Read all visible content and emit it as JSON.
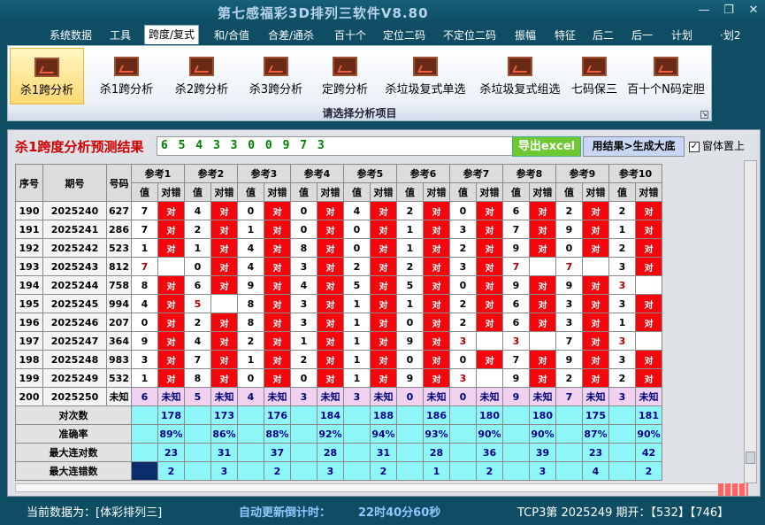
{
  "title": "第七感福彩3D排列三软件V8.80",
  "menu": [
    "系统数据",
    "工具",
    "跨度/复式",
    "和/合值",
    "合差/通杀",
    "百十个",
    "定位二码",
    "不定位二码",
    "振幅",
    "特征",
    "后二",
    "后一",
    "计划",
    "·划2"
  ],
  "ribbon": {
    "buttons": [
      "杀1跨分析",
      "杀1跨分析",
      "杀2跨分析",
      "杀3跨分析",
      "定跨分析",
      "杀垃圾复式单选",
      "杀垃圾复式组选",
      "七码保三",
      "百十个N码定胆"
    ],
    "group_label": "请选择分析项目"
  },
  "result": {
    "title": "杀1跨度分析预测结果",
    "value": "6 5 4 3 3 0 0 9 7 3",
    "excel": "导出excel",
    "gen": "用结果>生成大底",
    "pin_label": "窗体置上"
  },
  "table": {
    "headers": {
      "seq": "序号",
      "period": "期号",
      "code": "号码",
      "refs": [
        "参考1",
        "参考2",
        "参考3",
        "参考4",
        "参考5",
        "参考6",
        "参考7",
        "参考8",
        "参考9",
        "参考10"
      ],
      "val": "值",
      "judge": "对错"
    },
    "rows": [
      {
        "seq": "190",
        "period": "2025240",
        "code": "627",
        "vals": [
          "7",
          "4",
          "0",
          "0",
          "4",
          "2",
          "0",
          "6",
          "2",
          "2"
        ],
        "hit": [
          1,
          1,
          1,
          1,
          1,
          1,
          1,
          1,
          1,
          1
        ]
      },
      {
        "seq": "191",
        "period": "2025241",
        "code": "286",
        "vals": [
          "7",
          "2",
          "1",
          "0",
          "0",
          "1",
          "3",
          "7",
          "9",
          "1"
        ],
        "hit": [
          1,
          1,
          1,
          1,
          1,
          1,
          1,
          1,
          1,
          1
        ]
      },
      {
        "seq": "192",
        "period": "2025242",
        "code": "523",
        "vals": [
          "1",
          "1",
          "4",
          "8",
          "0",
          "1",
          "2",
          "9",
          "0",
          "2"
        ],
        "hit": [
          1,
          1,
          1,
          1,
          1,
          1,
          1,
          1,
          1,
          1
        ]
      },
      {
        "seq": "193",
        "period": "2025243",
        "code": "812",
        "vals": [
          "7",
          "0",
          "4",
          "3",
          "2",
          "2",
          "3",
          "7",
          "7",
          "3"
        ],
        "hit": [
          0,
          1,
          1,
          1,
          1,
          1,
          1,
          0,
          0,
          1
        ]
      },
      {
        "seq": "194",
        "period": "2025244",
        "code": "758",
        "vals": [
          "8",
          "6",
          "9",
          "4",
          "5",
          "5",
          "0",
          "9",
          "9",
          "3"
        ],
        "hit": [
          1,
          1,
          1,
          1,
          1,
          1,
          1,
          1,
          1,
          0
        ]
      },
      {
        "seq": "195",
        "period": "2025245",
        "code": "994",
        "vals": [
          "4",
          "5",
          "8",
          "3",
          "1",
          "1",
          "2",
          "6",
          "3",
          "3"
        ],
        "hit": [
          1,
          0,
          1,
          1,
          1,
          1,
          1,
          1,
          1,
          1
        ]
      },
      {
        "seq": "196",
        "period": "2025246",
        "code": "207",
        "vals": [
          "0",
          "2",
          "8",
          "3",
          "1",
          "0",
          "2",
          "6",
          "3",
          "1"
        ],
        "hit": [
          1,
          1,
          1,
          1,
          1,
          1,
          1,
          1,
          1,
          1
        ]
      },
      {
        "seq": "197",
        "period": "2025247",
        "code": "364",
        "vals": [
          "9",
          "4",
          "2",
          "1",
          "1",
          "9",
          "3",
          "3",
          "7",
          "3"
        ],
        "hit": [
          1,
          1,
          1,
          1,
          1,
          1,
          0,
          0,
          1,
          0
        ]
      },
      {
        "seq": "198",
        "period": "2025248",
        "code": "983",
        "vals": [
          "3",
          "7",
          "1",
          "2",
          "1",
          "0",
          "0",
          "7",
          "9",
          "3"
        ],
        "hit": [
          1,
          1,
          1,
          1,
          1,
          1,
          1,
          1,
          1,
          1
        ]
      },
      {
        "seq": "199",
        "period": "2025249",
        "code": "532",
        "vals": [
          "1",
          "8",
          "0",
          "0",
          "1",
          "9",
          "3",
          "9",
          "2",
          "2"
        ],
        "hit": [
          1,
          1,
          1,
          1,
          1,
          1,
          0,
          1,
          1,
          1
        ]
      }
    ],
    "pending": {
      "seq": "200",
      "period": "2025250",
      "code": "未知",
      "vals": [
        "6",
        "5",
        "4",
        "3",
        "3",
        "0",
        "0",
        "9",
        "7",
        "3"
      ],
      "judge": "未知"
    },
    "stats": [
      {
        "label": "对次数",
        "values": [
          "178",
          "173",
          "176",
          "184",
          "188",
          "186",
          "180",
          "180",
          "175",
          "181"
        ]
      },
      {
        "label": "准确率",
        "values": [
          "89%",
          "86%",
          "88%",
          "92%",
          "94%",
          "93%",
          "90%",
          "90%",
          "87%",
          "90%"
        ]
      },
      {
        "label": "最大连对数",
        "values": [
          "23",
          "31",
          "37",
          "28",
          "31",
          "28",
          "36",
          "39",
          "23",
          "42"
        ]
      },
      {
        "label": "最大连错数",
        "values": [
          "2",
          "3",
          "2",
          "3",
          "2",
          "1",
          "2",
          "3",
          "4",
          "2"
        ]
      }
    ],
    "hit_text": "对"
  },
  "status": {
    "current": "当前数据为：[体彩排列三]",
    "countdown_label": "自动更新倒计时：",
    "countdown": "22时40分60秒",
    "tcp": "TCP3第 2025249 期开：【532】【746】"
  }
}
